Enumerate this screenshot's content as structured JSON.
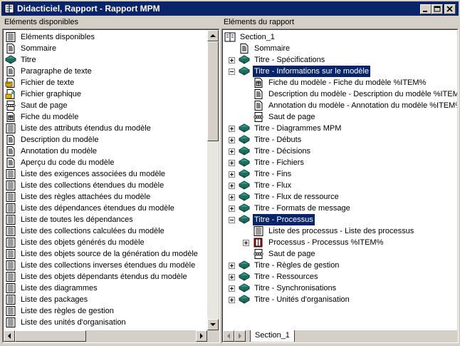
{
  "window": {
    "title": "Didacticiel, Rapport - Rapport MPM"
  },
  "left": {
    "header": "Eléments disponibles",
    "items": [
      {
        "label": "Eléments disponibles",
        "icon": "list-icon"
      },
      {
        "label": "Sommaire",
        "icon": "document-icon"
      },
      {
        "label": "Titre",
        "icon": "book-icon"
      },
      {
        "label": "Paragraphe de texte",
        "icon": "document-icon"
      },
      {
        "label": "Fichier de texte",
        "icon": "text-file-icon"
      },
      {
        "label": "Fichier graphique",
        "icon": "image-file-icon"
      },
      {
        "label": "Saut de page",
        "icon": "page-break-icon"
      },
      {
        "label": "Fiche du modèle",
        "icon": "model-sheet-icon"
      },
      {
        "label": "Liste des attributs étendus du modèle",
        "icon": "list-icon"
      },
      {
        "label": "Description du modèle",
        "icon": "document-icon"
      },
      {
        "label": "Annotation du modèle",
        "icon": "document-icon"
      },
      {
        "label": "Aperçu du code du modèle",
        "icon": "document-icon"
      },
      {
        "label": "Liste des exigences associées du modèle",
        "icon": "list-icon"
      },
      {
        "label": "Liste des collections étendues du modèle",
        "icon": "list-icon"
      },
      {
        "label": "Liste des règles attachées du modèle",
        "icon": "list-icon"
      },
      {
        "label": "Liste des dépendances étendues du modèle",
        "icon": "list-icon"
      },
      {
        "label": "Liste de toutes les dépendances",
        "icon": "list-icon"
      },
      {
        "label": "Liste des collections calculées du modèle",
        "icon": "list-icon"
      },
      {
        "label": "Liste des objets générés du modèle",
        "icon": "list-icon"
      },
      {
        "label": "Liste des objets source de la génération du modèle",
        "icon": "list-icon"
      },
      {
        "label": "Liste des collections inverses étendues du modèle",
        "icon": "list-icon"
      },
      {
        "label": "Liste des objets dépendants étendus du modèle",
        "icon": "list-icon"
      },
      {
        "label": "Liste des diagrammes",
        "icon": "list-icon"
      },
      {
        "label": "Liste des packages",
        "icon": "list-icon"
      },
      {
        "label": "Liste des règles de gestion",
        "icon": "list-icon"
      },
      {
        "label": "Liste des unités d'organisation",
        "icon": "list-icon"
      }
    ]
  },
  "right": {
    "header": "Eléments du rapport",
    "tab": "Section_1",
    "items": [
      {
        "label": "Section_1",
        "icon": "section-icon",
        "level": 0,
        "expander": "none",
        "selected": false
      },
      {
        "label": "Sommaire",
        "icon": "document-icon",
        "level": 1,
        "expander": "none",
        "selected": false
      },
      {
        "label": "Titre - Spécifications",
        "icon": "book-icon",
        "level": 1,
        "expander": "plus",
        "selected": false
      },
      {
        "label": "Titre - Informations sur le modèle",
        "icon": "book-icon",
        "level": 1,
        "expander": "minus",
        "selected": true
      },
      {
        "label": "Fiche du modèle - Fiche du modèle %ITEM%",
        "icon": "model-sheet-icon",
        "level": 2,
        "expander": "none",
        "selected": false
      },
      {
        "label": "Description du modèle - Description du modèle %ITEM%",
        "icon": "document-icon",
        "level": 2,
        "expander": "none",
        "selected": false
      },
      {
        "label": "Annotation du modèle - Annotation du modèle %ITEM%",
        "icon": "document-icon",
        "level": 2,
        "expander": "none",
        "selected": false
      },
      {
        "label": "Saut de page",
        "icon": "page-break-icon",
        "level": 2,
        "expander": "none",
        "selected": false
      },
      {
        "label": "Titre - Diagrammes MPM",
        "icon": "book-icon",
        "level": 1,
        "expander": "plus",
        "selected": false
      },
      {
        "label": "Titre - Débuts",
        "icon": "book-icon",
        "level": 1,
        "expander": "plus",
        "selected": false
      },
      {
        "label": "Titre - Décisions",
        "icon": "book-icon",
        "level": 1,
        "expander": "plus",
        "selected": false
      },
      {
        "label": "Titre - Fichiers",
        "icon": "book-icon",
        "level": 1,
        "expander": "plus",
        "selected": false
      },
      {
        "label": "Titre - Fins",
        "icon": "book-icon",
        "level": 1,
        "expander": "plus",
        "selected": false
      },
      {
        "label": "Titre - Flux",
        "icon": "book-icon",
        "level": 1,
        "expander": "plus",
        "selected": false
      },
      {
        "label": "Titre - Flux de ressource",
        "icon": "book-icon",
        "level": 1,
        "expander": "plus",
        "selected": false
      },
      {
        "label": "Titre - Formats de message",
        "icon": "book-icon",
        "level": 1,
        "expander": "plus",
        "selected": false
      },
      {
        "label": "Titre - Processus",
        "icon": "book-icon",
        "level": 1,
        "expander": "minus",
        "selected": true
      },
      {
        "label": "Liste des processus - Liste des processus",
        "icon": "list-icon",
        "level": 2,
        "expander": "none",
        "selected": false
      },
      {
        "label": "Processus - Processus %ITEM%",
        "icon": "red-book-icon",
        "level": 2,
        "expander": "plus",
        "selected": false
      },
      {
        "label": "Saut de page",
        "icon": "page-break-icon",
        "level": 2,
        "expander": "none",
        "selected": false
      },
      {
        "label": "Titre - Règles de gestion",
        "icon": "book-icon",
        "level": 1,
        "expander": "plus",
        "selected": false
      },
      {
        "label": "Titre - Ressources",
        "icon": "book-icon",
        "level": 1,
        "expander": "plus",
        "selected": false
      },
      {
        "label": "Titre - Synchronisations",
        "icon": "book-icon",
        "level": 1,
        "expander": "plus",
        "selected": false
      },
      {
        "label": "Titre - Unités d'organisation",
        "icon": "book-icon",
        "level": 1,
        "expander": "plus",
        "selected": false
      }
    ]
  },
  "colors": {
    "titlebar": "#0a246a",
    "selection": "#0a246a",
    "face": "#d4d0c8",
    "book_green": "#1e7a6a",
    "book_red": "#b01818"
  }
}
